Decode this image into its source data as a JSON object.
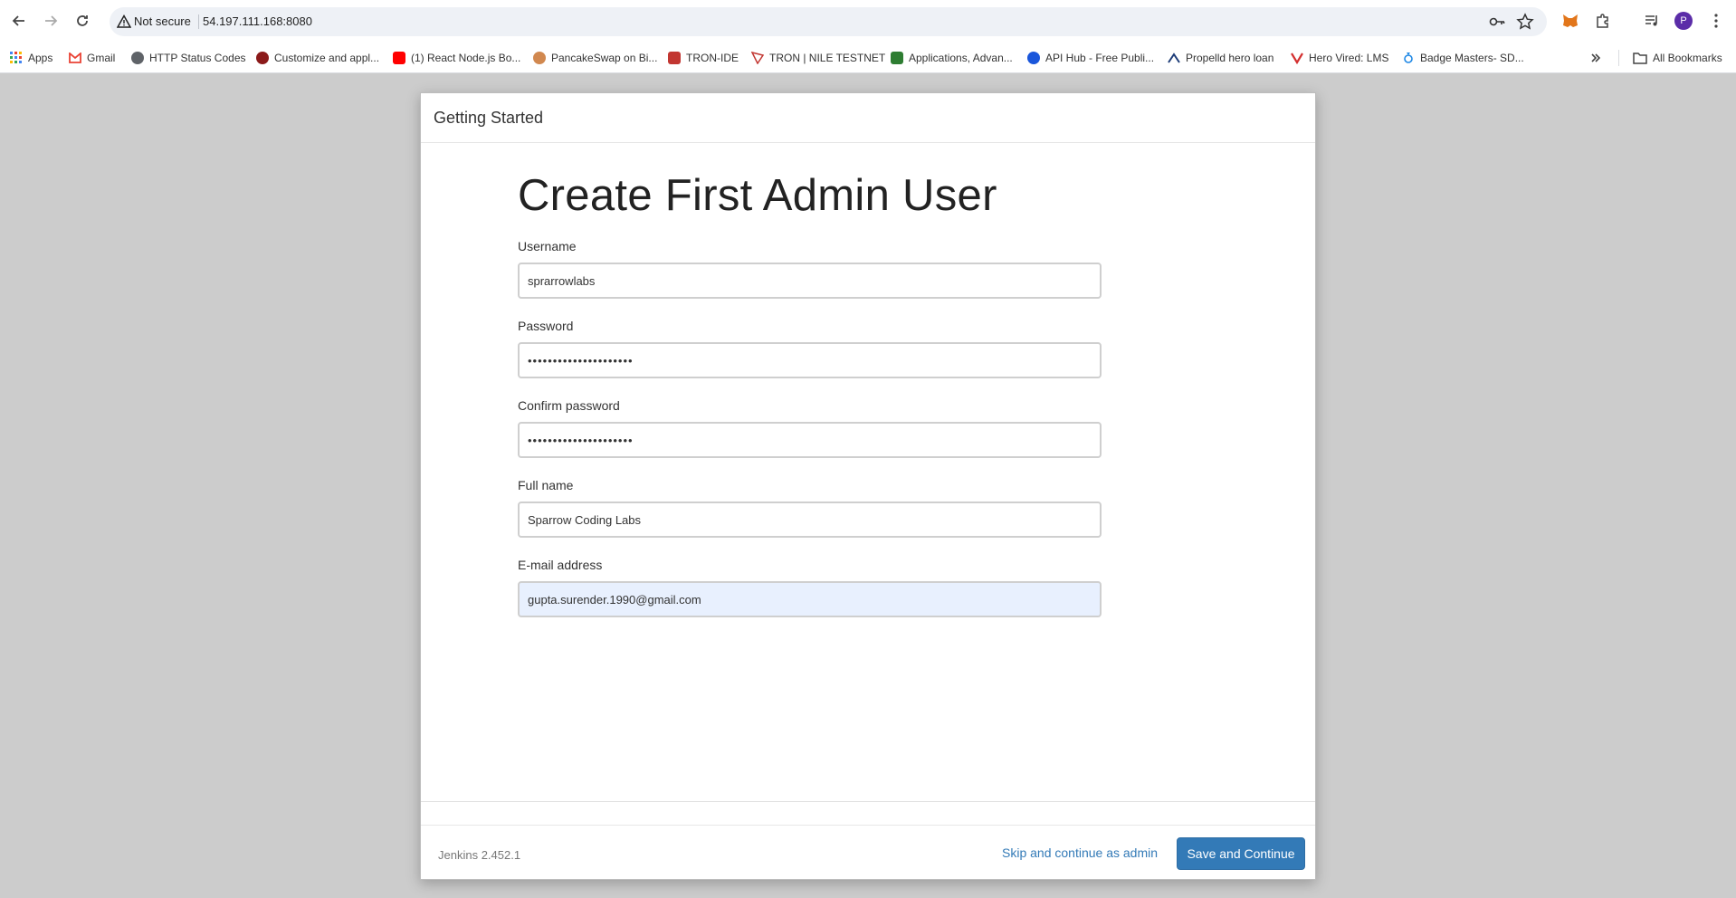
{
  "browser": {
    "security_label": "Not secure",
    "url": "54.197.111.168:8080",
    "avatar_letter": "P",
    "all_bookmarks_label": "All Bookmarks",
    "bookmarks": [
      {
        "label": "Apps",
        "color": "#4285f4"
      },
      {
        "label": "Gmail",
        "color": "#ea4335"
      },
      {
        "label": "HTTP Status Codes",
        "color": "#5f6368"
      },
      {
        "label": "Customize and appl...",
        "color": "#8b1a1a"
      },
      {
        "label": "(1) React Node.js Bo...",
        "color": "#ff0000"
      },
      {
        "label": "PancakeSwap on Bi...",
        "color": "#d1884f"
      },
      {
        "label": "TRON-IDE",
        "color": "#c23631"
      },
      {
        "label": "TRON | NILE TESTNET",
        "color": "#c23631"
      },
      {
        "label": "Applications, Advan...",
        "color": "#2e7d32"
      },
      {
        "label": "API Hub - Free Publi...",
        "color": "#1a56db"
      },
      {
        "label": "Propelld hero loan",
        "color": "#1d3c78"
      },
      {
        "label": "Hero Vired: LMS",
        "color": "#d32f2f"
      },
      {
        "label": "Badge Masters- SD...",
        "color": "#1e88e5"
      }
    ]
  },
  "dialog": {
    "header_title": "Getting Started",
    "page_title": "Create First Admin User",
    "fields": {
      "username": {
        "label": "Username",
        "value": "sprarrowlabs"
      },
      "password": {
        "label": "Password",
        "value": "•••••••••••••••••••••"
      },
      "confirm_password": {
        "label": "Confirm password",
        "value": "•••••••••••••••••••••"
      },
      "full_name": {
        "label": "Full name",
        "value": "Sparrow Coding Labs"
      },
      "email": {
        "label": "E-mail address",
        "value": "gupta.surender.1990@gmail.com"
      }
    },
    "footer": {
      "version": "Jenkins 2.452.1",
      "skip_label": "Skip and continue as admin",
      "save_label": "Save and Continue"
    }
  },
  "colors": {
    "primary_button": "#337ab7",
    "page_background": "#cccccc",
    "autofill_background": "#e8f0fe"
  }
}
